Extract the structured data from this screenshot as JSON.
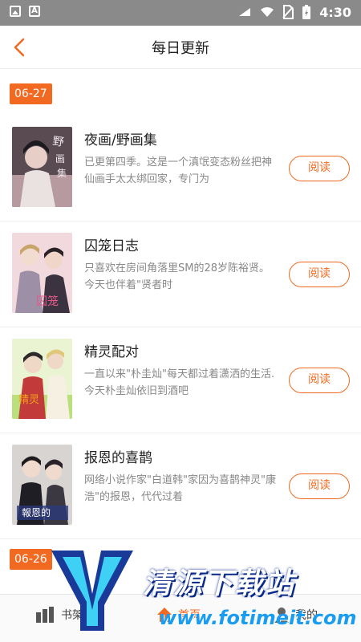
{
  "status_bar": {
    "time": "4:30"
  },
  "header": {
    "title": "每日更新"
  },
  "sections": [
    {
      "date": "06-27"
    },
    {
      "date": "06-26"
    }
  ],
  "items": [
    {
      "title": "夜画/野画集",
      "desc": "已更第四季。这是一个滇氓变态粉丝把神仙画手太太绑回家，专门为",
      "read_label": "阅读"
    },
    {
      "title": "囚笼日志",
      "desc": "只喜欢在房间角落里SM的28岁陈裕贤。 今天也伴着\"贤者时",
      "read_label": "阅读"
    },
    {
      "title": "精灵配对",
      "desc": "一直以来\"朴圭灿\"每天都过着潇洒的生活.今天朴圭灿依旧到酒吧",
      "read_label": "阅读"
    },
    {
      "title": "报恩的喜鹊",
      "desc": "网络小说作家\"白道韩\"家因为喜鹊神灵\"康浩\"的报恩，代代过着",
      "read_label": "阅读"
    }
  ],
  "bottom_nav": [
    {
      "label": "书架",
      "icon": "bookshelf-icon"
    },
    {
      "label": "首页",
      "icon": "home-icon"
    },
    {
      "label": "我的",
      "icon": "profile-icon"
    }
  ],
  "watermark": {
    "title": "清源下载站",
    "url": "www.fotimeit.com"
  },
  "colors": {
    "accent": "#f26a22",
    "status_bar": "#8a8a8a"
  }
}
